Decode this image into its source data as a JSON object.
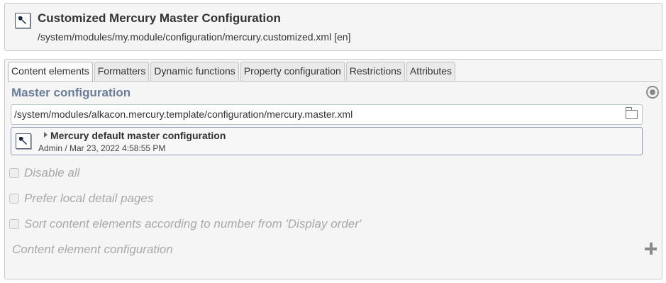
{
  "header": {
    "icon": "wrench-icon",
    "title": "Customized Mercury Master Configuration",
    "path": "/system/modules/my.module/configuration/mercury.customized.xml [en]"
  },
  "tabs": [
    {
      "label": "Content elements",
      "active": true
    },
    {
      "label": "Formatters"
    },
    {
      "label": "Dynamic functions"
    },
    {
      "label": "Property configuration"
    },
    {
      "label": "Restrictions"
    },
    {
      "label": "Attributes"
    }
  ],
  "master": {
    "section_title": "Master configuration",
    "path_value": "/system/modules/alkacon.mercury.template/configuration/mercury.master.xml",
    "resource_title": "Mercury default master configuration",
    "resource_meta": "Admin / Mar 23, 2022 4:58:55 PM"
  },
  "options": [
    {
      "label": "Disable all",
      "checked": false
    },
    {
      "label": "Prefer local detail pages",
      "checked": false
    },
    {
      "label": "Sort content elements according to number from 'Display order'",
      "checked": false
    }
  ],
  "content_element_config": {
    "label": "Content element configuration"
  },
  "colors": {
    "section_title": "#6a7d9a",
    "disabled_text": "#a8a8a8",
    "panel_bg": "#f5f5f5"
  }
}
